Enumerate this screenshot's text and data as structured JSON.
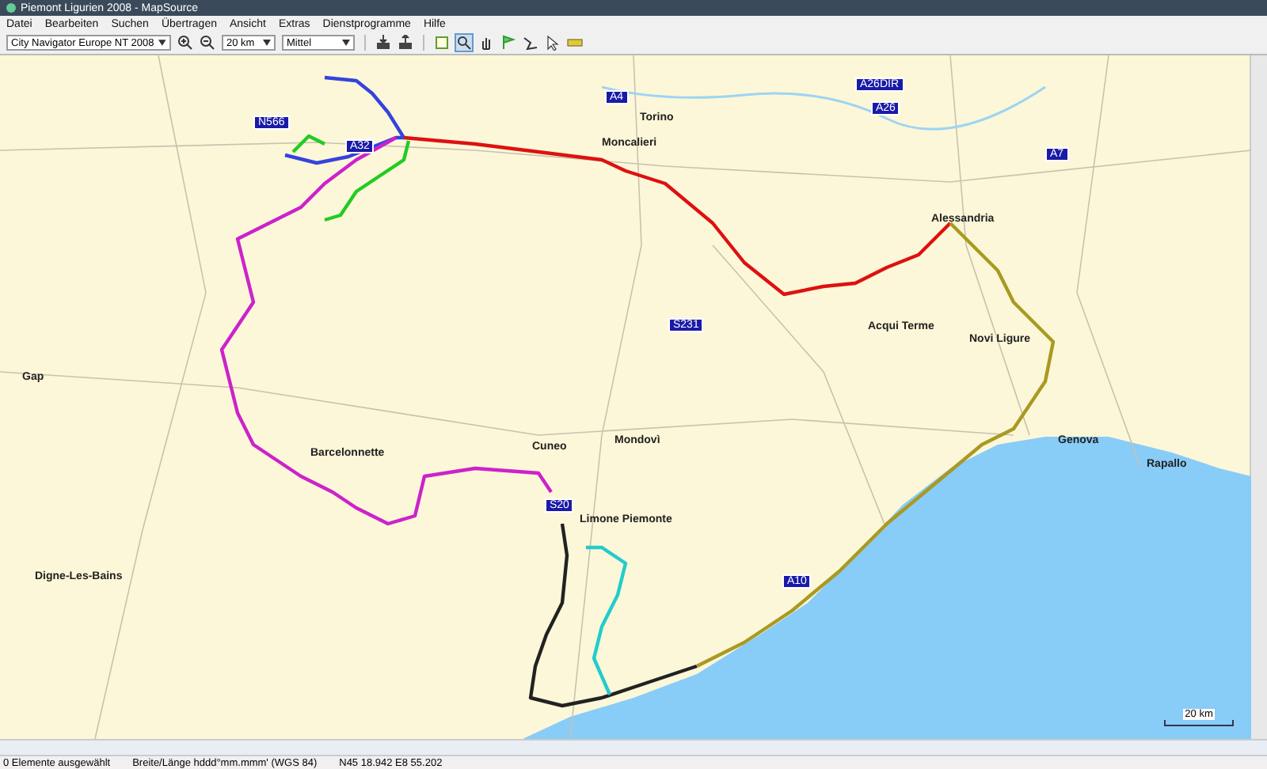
{
  "window": {
    "title": "Piemont Ligurien 2008 - MapSource"
  },
  "menu": [
    "Datei",
    "Bearbeiten",
    "Suchen",
    "Übertragen",
    "Ansicht",
    "Extras",
    "Dienstprogramme",
    "Hilfe"
  ],
  "toolbar": {
    "map_product": "City Navigator Europe NT 2008",
    "zoom": "20 km",
    "detail": "Mittel"
  },
  "map": {
    "labels": [
      {
        "text": "Torino",
        "kind": "city"
      },
      {
        "text": "Moncalieri",
        "kind": "city"
      },
      {
        "text": "Alessandria",
        "kind": "city"
      },
      {
        "text": "Acqui Terme",
        "kind": "city"
      },
      {
        "text": "Genova",
        "kind": "city"
      },
      {
        "text": "Cuneo",
        "kind": "city"
      },
      {
        "text": "Mondovì",
        "kind": "city"
      },
      {
        "text": "Limone Piemonte",
        "kind": "city"
      },
      {
        "text": "Barcelonnette",
        "kind": "city"
      },
      {
        "text": "Gap",
        "kind": "city"
      },
      {
        "text": "Digne-Les-Bains",
        "kind": "city"
      },
      {
        "text": "Rapallo",
        "kind": "city"
      },
      {
        "text": "Novi Ligure",
        "kind": "city"
      },
      {
        "text": "N566",
        "kind": "road"
      },
      {
        "text": "A32",
        "kind": "road"
      },
      {
        "text": "A4",
        "kind": "road"
      },
      {
        "text": "A26DIR",
        "kind": "road"
      },
      {
        "text": "A26",
        "kind": "road"
      },
      {
        "text": "A7",
        "kind": "road"
      },
      {
        "text": "S231",
        "kind": "road"
      },
      {
        "text": "S20",
        "kind": "road"
      },
      {
        "text": "A10",
        "kind": "road"
      }
    ],
    "scale": "20 km"
  },
  "status_bar": [
    "0 Elemente ausgewählt",
    "Breite/Länge hddd°mm.mmm' (WGS 84)",
    "N45 18.942 E8 55.202"
  ]
}
